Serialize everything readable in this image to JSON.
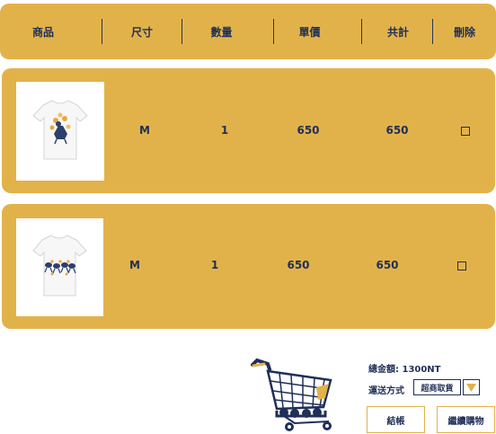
{
  "table": {
    "headers": {
      "product": "商品",
      "size": "尺寸",
      "quantity": "數量",
      "unit_price": "單價",
      "total": "共計",
      "delete": "刪除"
    },
    "rows": [
      {
        "product_image": "tshirt-cat-flowers-image",
        "size": "M",
        "quantity": "1",
        "unit_price": "650",
        "total": "650",
        "delete_checked": false
      },
      {
        "product_image": "tshirt-dancing-birds-image",
        "size": "M",
        "quantity": "1",
        "unit_price": "650",
        "total": "650",
        "delete_checked": false
      }
    ]
  },
  "summary": {
    "total_amount": "總金額: 1300NT",
    "shipping_label": "運送方式",
    "shipping_value": "超商取貨"
  },
  "actions": {
    "checkout": "結帳",
    "continue_shopping": "繼續購物"
  },
  "decor": {
    "cart_icon": "shopping-cart-icon"
  },
  "colors": {
    "accent": "#e2b24a",
    "text": "#1f2f57",
    "background": "#ffffff"
  }
}
